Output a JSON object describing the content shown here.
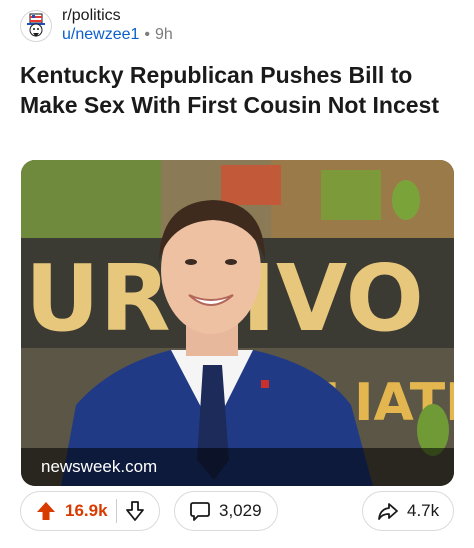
{
  "post": {
    "subreddit": "r/politics",
    "username": "u/newzee1",
    "separator": "•",
    "age": "9h",
    "title": "Kentucky Republican Pushes Bill to Make Sex With First Cousin Not Incest"
  },
  "media": {
    "source": "newsweek.com",
    "backdrop_text": "URVIVO",
    "backdrop_text2": "LIATI"
  },
  "actions": {
    "upvotes": "16.9k",
    "comments": "3,029",
    "shares": "4.7k"
  },
  "colors": {
    "upvote_active": "#d93a00",
    "link": "#0b5fcc",
    "meta_gray": "#7c7c7c"
  },
  "icons": {
    "avatar": "uncle-sam-icon",
    "upvote": "arrow-up-icon",
    "downvote": "arrow-down-icon",
    "comment": "speech-bubble-icon",
    "share": "share-arrow-icon"
  }
}
